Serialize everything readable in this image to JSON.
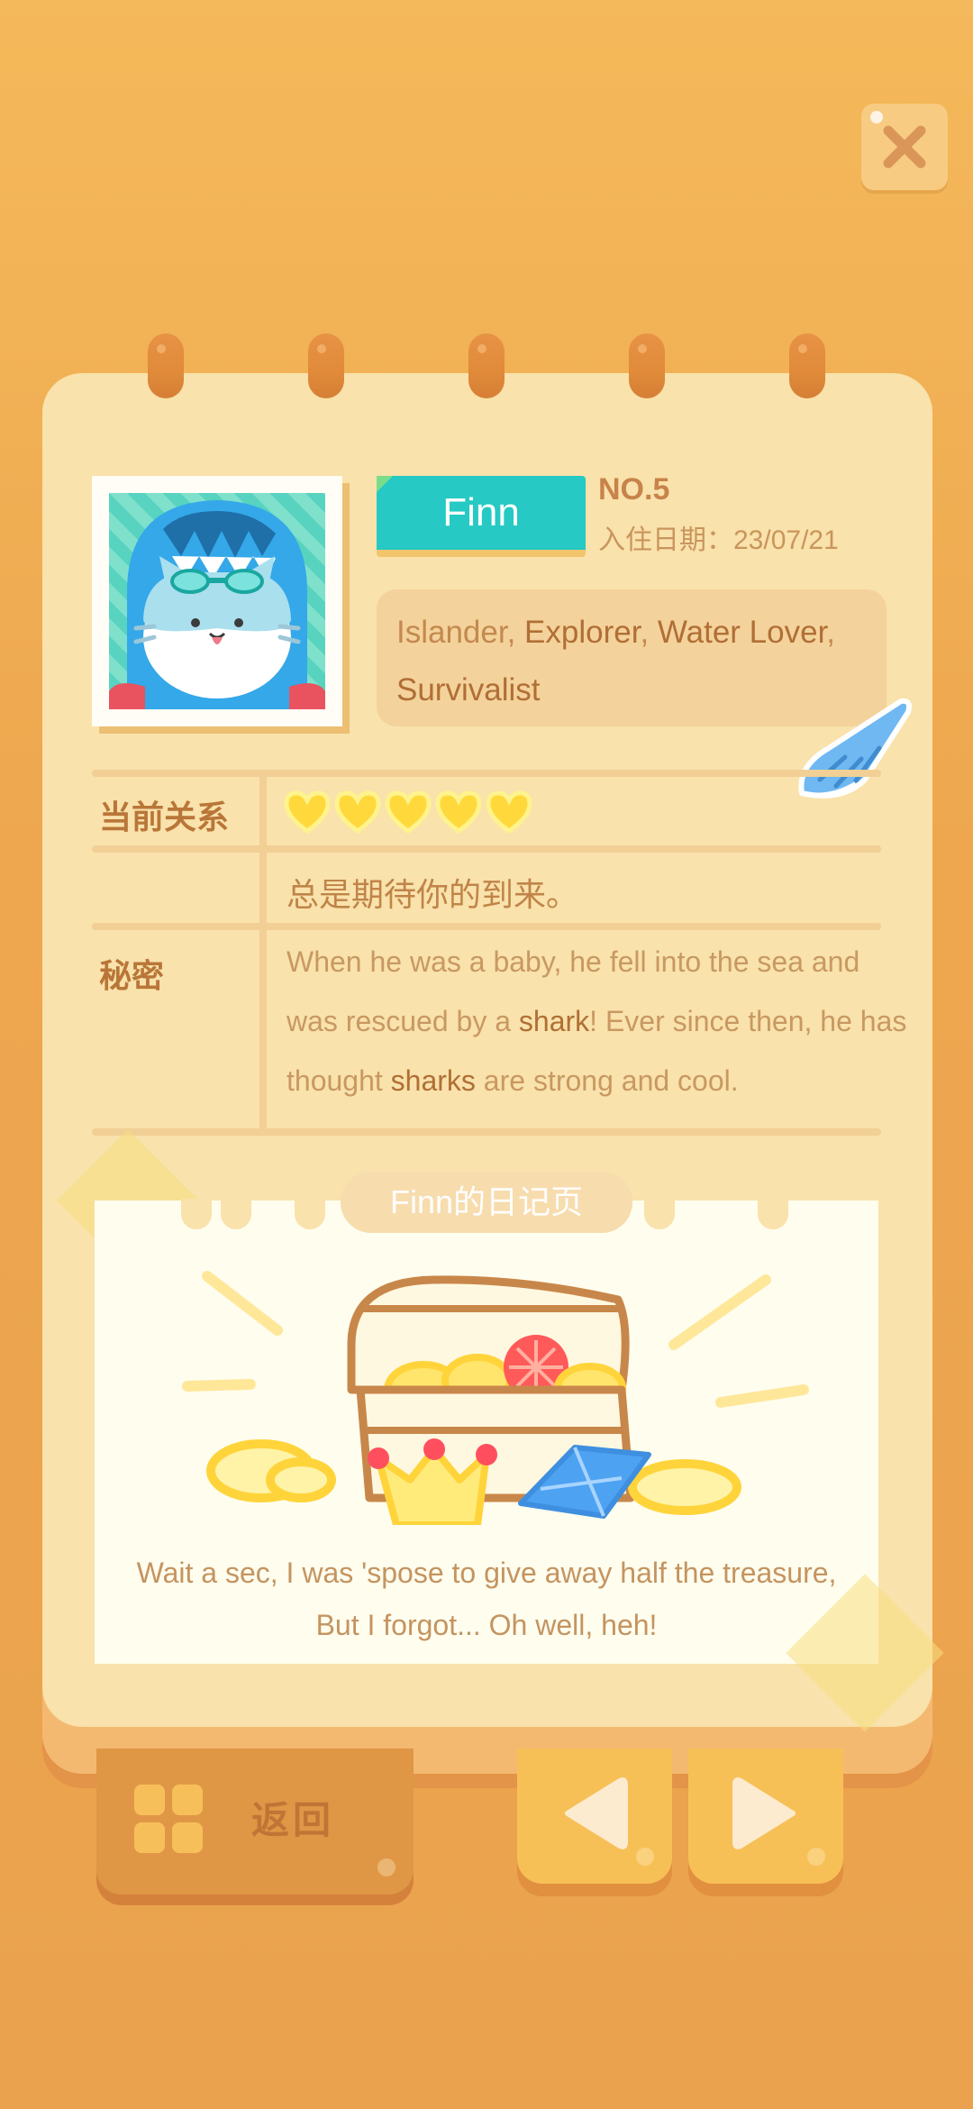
{
  "character": {
    "name": "Finn",
    "number": "NO.5",
    "move_in_date": "入住日期：23/07/21",
    "traits": [
      {
        "text": "Islander",
        "highlight": false
      },
      {
        "text": ", ",
        "highlight": false
      },
      {
        "text": "Explorer",
        "highlight": true
      },
      {
        "text": ", ",
        "highlight": false
      },
      {
        "text": "Water Lover",
        "highlight": true
      },
      {
        "text": ", ",
        "highlight": false
      },
      {
        "text": "Survivalist",
        "highlight": true
      }
    ]
  },
  "relationship": {
    "label": "当前关系",
    "hearts_filled": 5,
    "hearts_total": 5,
    "description": "总是期待你的到来。"
  },
  "secret": {
    "label": "秘密",
    "parts": [
      {
        "text": "When he was a baby, he fell into the sea and was rescued by a ",
        "highlight": false
      },
      {
        "text": "shark",
        "highlight": true
      },
      {
        "text": "! Ever since then, he has thought ",
        "highlight": false
      },
      {
        "text": "sharks",
        "highlight": true
      },
      {
        "text": " are strong and cool.",
        "highlight": false
      }
    ]
  },
  "diary": {
    "title": "Finn的日记页",
    "caption_line1": "Wait a sec, I was 'spose to give away half the treasure,",
    "caption_line2": "But I forgot... Oh well, heh!"
  },
  "buttons": {
    "back_label": "返回"
  },
  "colors": {
    "background": "#eea74f",
    "page": "#f9e2ab",
    "name_tag": "#26c9c3",
    "heart": "#ffd93b"
  },
  "icons": [
    "close-icon",
    "shell-icon",
    "grid-icon",
    "arrow-left-icon",
    "arrow-right-icon",
    "heart-icon"
  ]
}
